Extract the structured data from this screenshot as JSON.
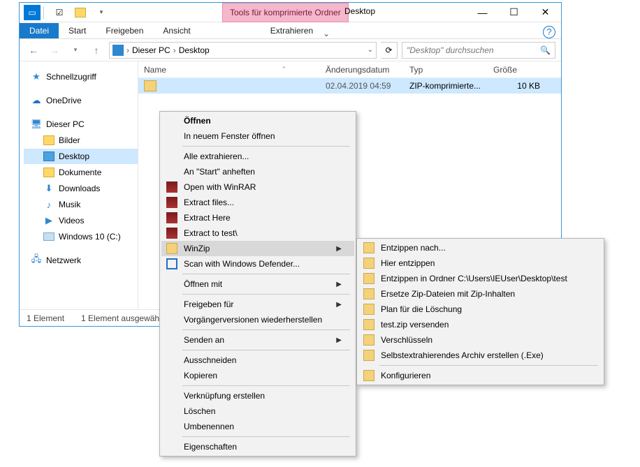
{
  "titlebar": {
    "tools_label": "Tools für komprimierte Ordner",
    "title": "Desktop"
  },
  "tabs": {
    "file": "Datei",
    "start": "Start",
    "share": "Freigeben",
    "view": "Ansicht",
    "extract": "Extrahieren"
  },
  "addressbar": {
    "pc": "Dieser PC",
    "location": "Desktop",
    "search_placeholder": "\"Desktop\" durchsuchen"
  },
  "navpane": {
    "quick": "Schnellzugriff",
    "onedrive": "OneDrive",
    "thispc": "Dieser PC",
    "pictures": "Bilder",
    "desktop": "Desktop",
    "documents": "Dokumente",
    "downloads": "Downloads",
    "music": "Musik",
    "videos": "Videos",
    "cdrive": "Windows 10 (C:)",
    "network": "Netzwerk"
  },
  "columns": {
    "name": "Name",
    "date": "Änderungsdatum",
    "type": "Typ",
    "size": "Größe"
  },
  "row": {
    "date": "02.04.2019 04:59",
    "type": "ZIP-komprimierte...",
    "size": "10 KB"
  },
  "status": {
    "count": "1 Element",
    "selected": "1 Element ausgewähl"
  },
  "context_menu": {
    "open": "Öffnen",
    "open_new": "In neuem Fenster öffnen",
    "extract_all": "Alle extrahieren...",
    "pin_start": "An \"Start\" anheften",
    "winrar_open": "Open with WinRAR",
    "winrar_extract_files": "Extract files...",
    "winrar_extract_here": "Extract Here",
    "winrar_extract_to": "Extract to test\\",
    "winzip": "WinZip",
    "defender": "Scan with Windows Defender...",
    "open_with": "Öffnen mit",
    "share_with": "Freigeben für",
    "restore": "Vorgängerversionen wiederherstellen",
    "send_to": "Senden an",
    "cut": "Ausschneiden",
    "copy": "Kopieren",
    "shortcut": "Verknüpfung erstellen",
    "delete": "Löschen",
    "rename": "Umbenennen",
    "properties": "Eigenschaften"
  },
  "winzip_menu": {
    "unzip_to": "Entzippen nach...",
    "unzip_here": "Hier entzippen",
    "unzip_folder": "Entzippen in Ordner C:\\Users\\IEUser\\Desktop\\test",
    "replace": "Ersetze Zip-Dateien mit Zip-Inhalten",
    "plan_delete": "Plan für die Löschung",
    "send": "test.zip versenden",
    "encrypt": "Verschlüsseln",
    "sfx": "Selbstextrahierendes Archiv erstellen (.Exe)",
    "configure": "Konfigurieren"
  }
}
